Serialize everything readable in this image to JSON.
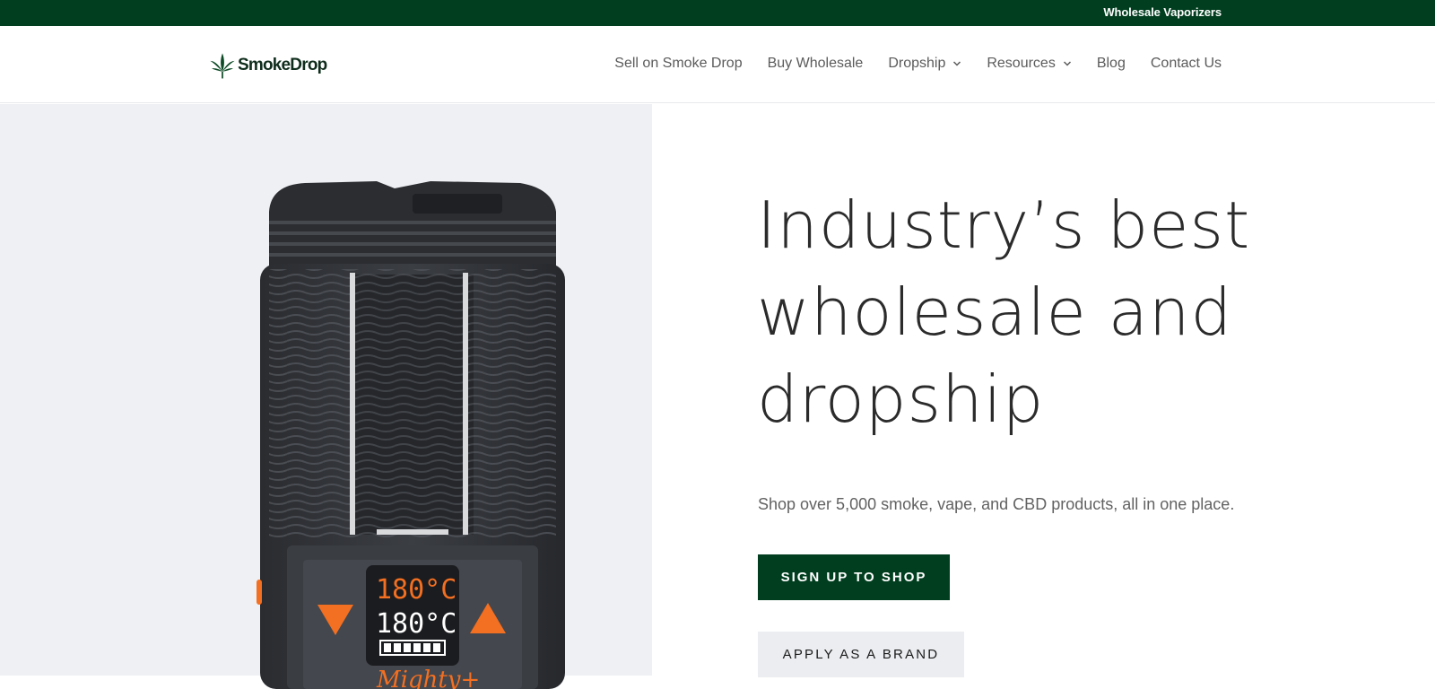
{
  "topbar": {
    "link": "Wholesale Vaporizers"
  },
  "header": {
    "logo_text": "SmokeDrop",
    "nav": [
      {
        "label": "Sell on Smoke Drop",
        "dropdown": false
      },
      {
        "label": "Buy Wholesale",
        "dropdown": false
      },
      {
        "label": "Dropship",
        "dropdown": true
      },
      {
        "label": "Resources",
        "dropdown": true
      },
      {
        "label": "Blog",
        "dropdown": false
      },
      {
        "label": "Contact Us",
        "dropdown": false
      }
    ]
  },
  "hero": {
    "headline": [
      "Industry’s best",
      "wholesale and",
      "dropship"
    ],
    "subline": "Shop over 5,000 smoke, vape, and CBD products, all in one place.",
    "primary_button": "SIGN UP TO SHOP",
    "secondary_button": "APPLY AS A BRAND",
    "device": {
      "display_top": "180°C",
      "display_bottom": "180°C",
      "brand_script": "Mighty+"
    }
  },
  "colors": {
    "brand_green": "#013e1f",
    "hero_bg": "#eef0f4",
    "accent_orange": "#f36f21"
  },
  "icons": [
    "cannabis-leaf-icon",
    "chevron-down-icon"
  ]
}
